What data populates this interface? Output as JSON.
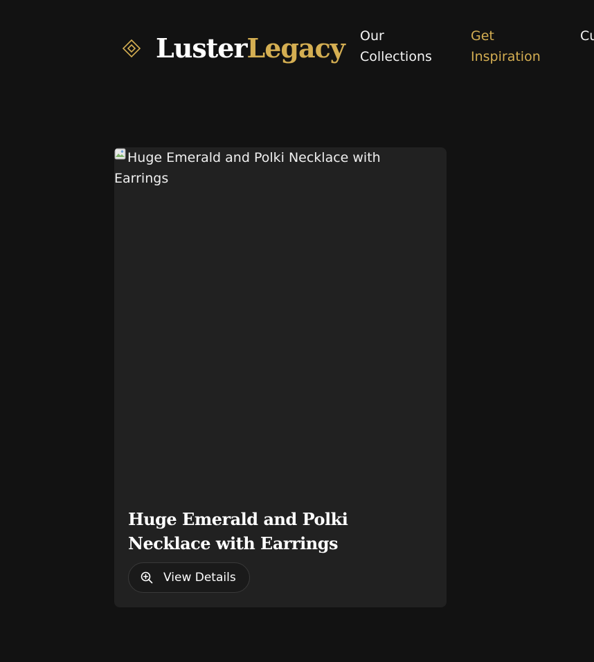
{
  "brand": {
    "name_part1": "Luster",
    "name_part2": "Legacy",
    "icon": "diamond-outline-icon",
    "accent_color": "#d4ae52"
  },
  "nav": {
    "items": [
      {
        "label": "Our Collections",
        "active": false
      },
      {
        "label": "Get Inspiration",
        "active": true
      },
      {
        "label": "Cu De",
        "active": false
      }
    ]
  },
  "product_card": {
    "image_alt": "Huge Emerald and Polki Necklace with Earrings",
    "title": "Huge Emerald and Polki Necklace with Earrings",
    "button_label": "View Details",
    "button_icon": "zoom-in-icon"
  }
}
